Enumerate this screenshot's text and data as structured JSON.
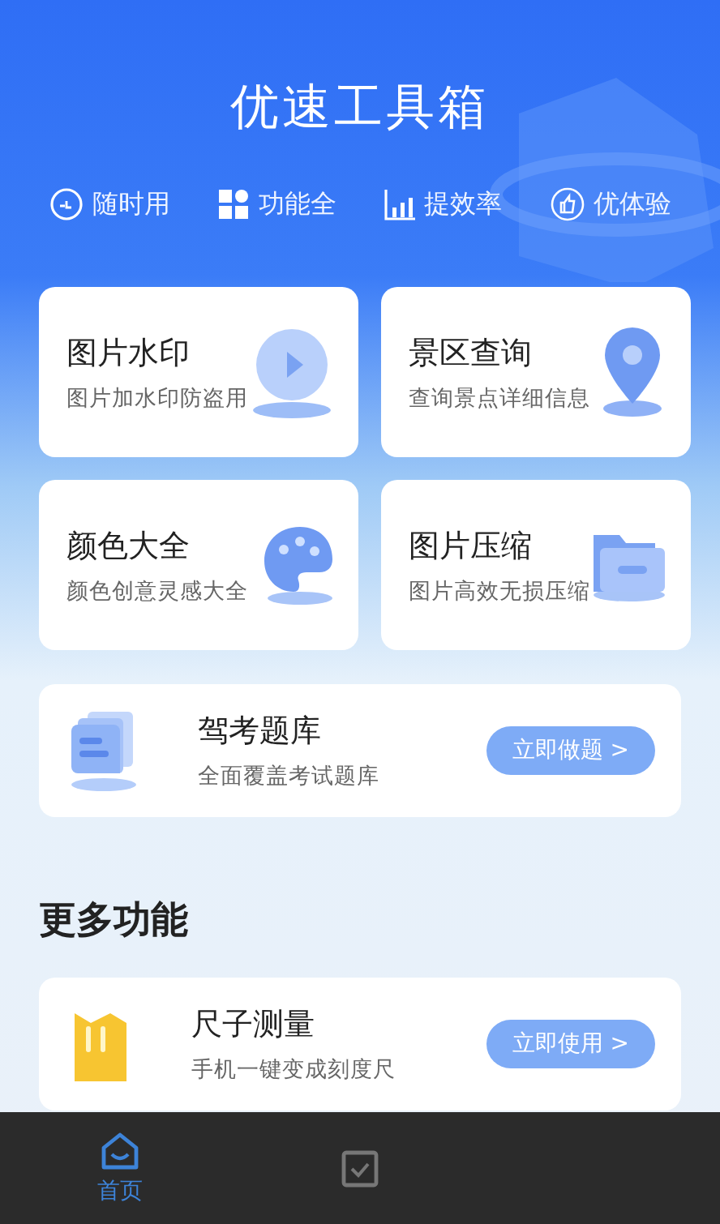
{
  "header": {
    "title": "优速工具箱",
    "features": [
      {
        "label": "随时用"
      },
      {
        "label": "功能全"
      },
      {
        "label": "提效率"
      },
      {
        "label": "优体验"
      }
    ]
  },
  "tools": [
    {
      "title": "图片水印",
      "subtitle": "图片加水印防盗用"
    },
    {
      "title": "景区查询",
      "subtitle": "查询景点详细信息"
    },
    {
      "title": "颜色大全",
      "subtitle": "颜色创意灵感大全"
    },
    {
      "title": "图片压缩",
      "subtitle": "图片高效无损压缩"
    }
  ],
  "featured": {
    "title": "驾考题库",
    "subtitle": "全面覆盖考试题库",
    "button": "立即做题 >"
  },
  "more": {
    "heading": "更多功能",
    "items": [
      {
        "title": "尺子测量",
        "subtitle": "手机一键变成刻度尺",
        "button": "立即使用 >"
      }
    ]
  },
  "nav": [
    {
      "label": "首页",
      "selected": true
    },
    {
      "selected": false
    }
  ]
}
